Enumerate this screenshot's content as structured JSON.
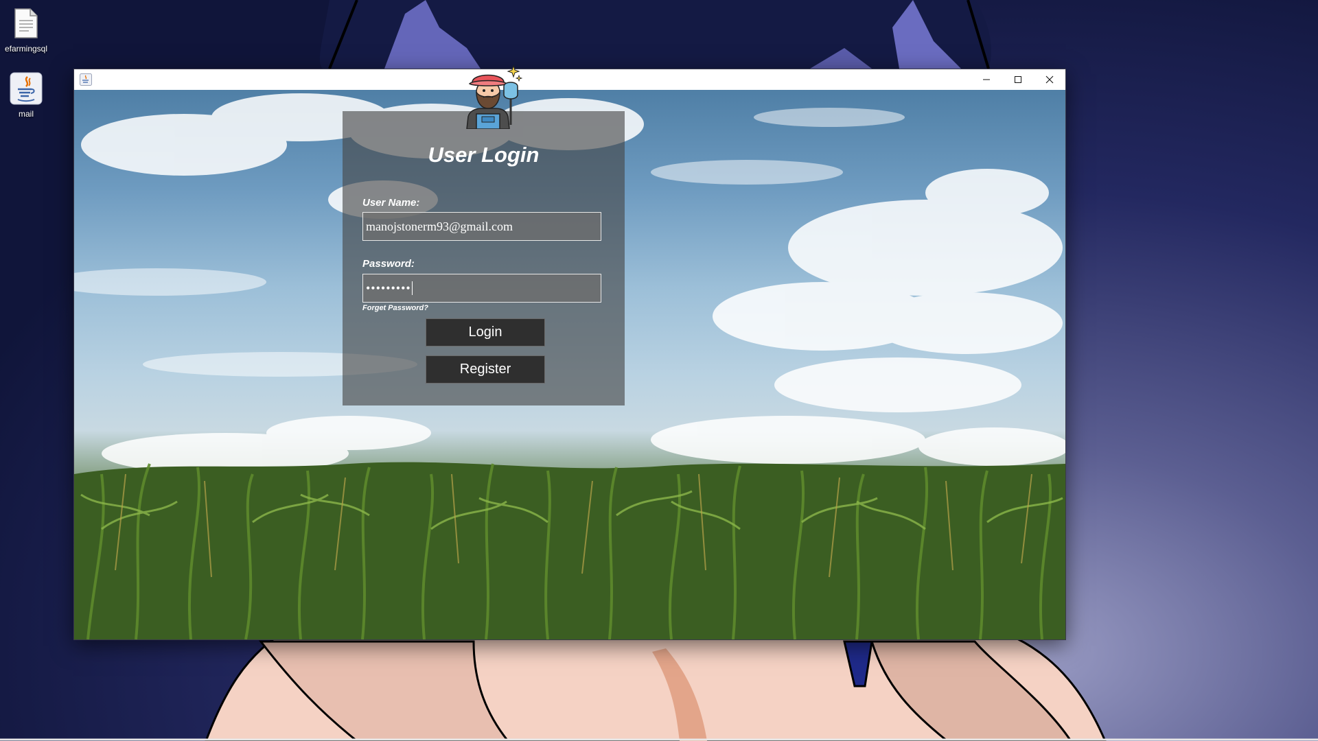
{
  "desktop": {
    "icons": [
      {
        "label": "efarmingsql",
        "icon": "document-icon"
      },
      {
        "label": "mail",
        "icon": "java-icon"
      }
    ]
  },
  "window": {
    "app_icon": "java-icon",
    "controls": {
      "minimize": "minimize-icon",
      "maximize": "maximize-icon",
      "close": "close-icon"
    }
  },
  "login": {
    "title": "User Login",
    "avatar_icon": "farmer-icon",
    "username_label": "User Name:",
    "username_value": "manojstonerm93@gmail.com",
    "password_label": "Password:",
    "password_value": "•••••••••",
    "forgot_label": "Forget Password?",
    "login_label": "Login",
    "register_label": "Register"
  },
  "colors": {
    "panel_bg": "#464646",
    "button_bg": "#2f2f2f",
    "text": "#ffffff"
  }
}
